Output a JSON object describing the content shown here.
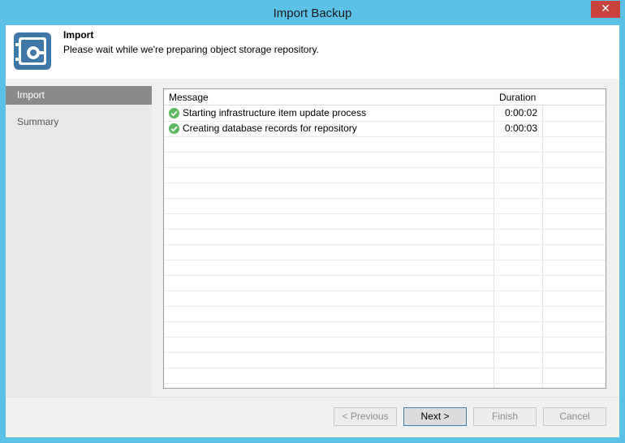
{
  "window": {
    "title": "Import Backup",
    "close_glyph": "✕"
  },
  "header": {
    "icon": "vault-icon",
    "title": "Import",
    "subtitle": "Please wait while we're preparing object storage repository."
  },
  "sidebar": {
    "items": [
      {
        "label": "Import",
        "active": true
      },
      {
        "label": "Summary",
        "active": false
      }
    ]
  },
  "log": {
    "columns": {
      "message": "Message",
      "duration": "Duration"
    },
    "rows": [
      {
        "status": "success",
        "message": "Starting infrastructure item update process",
        "duration": "0:00:02"
      },
      {
        "status": "success",
        "message": "Creating database records for repository",
        "duration": "0:00:03"
      }
    ]
  },
  "buttons": {
    "previous": "< Previous",
    "next": "Next >",
    "finish": "Finish",
    "cancel": "Cancel"
  },
  "colors": {
    "titlebar": "#5cc1e6",
    "close": "#c8413a",
    "success": "#5cb85c",
    "selected_step": "#8a8a8a"
  }
}
